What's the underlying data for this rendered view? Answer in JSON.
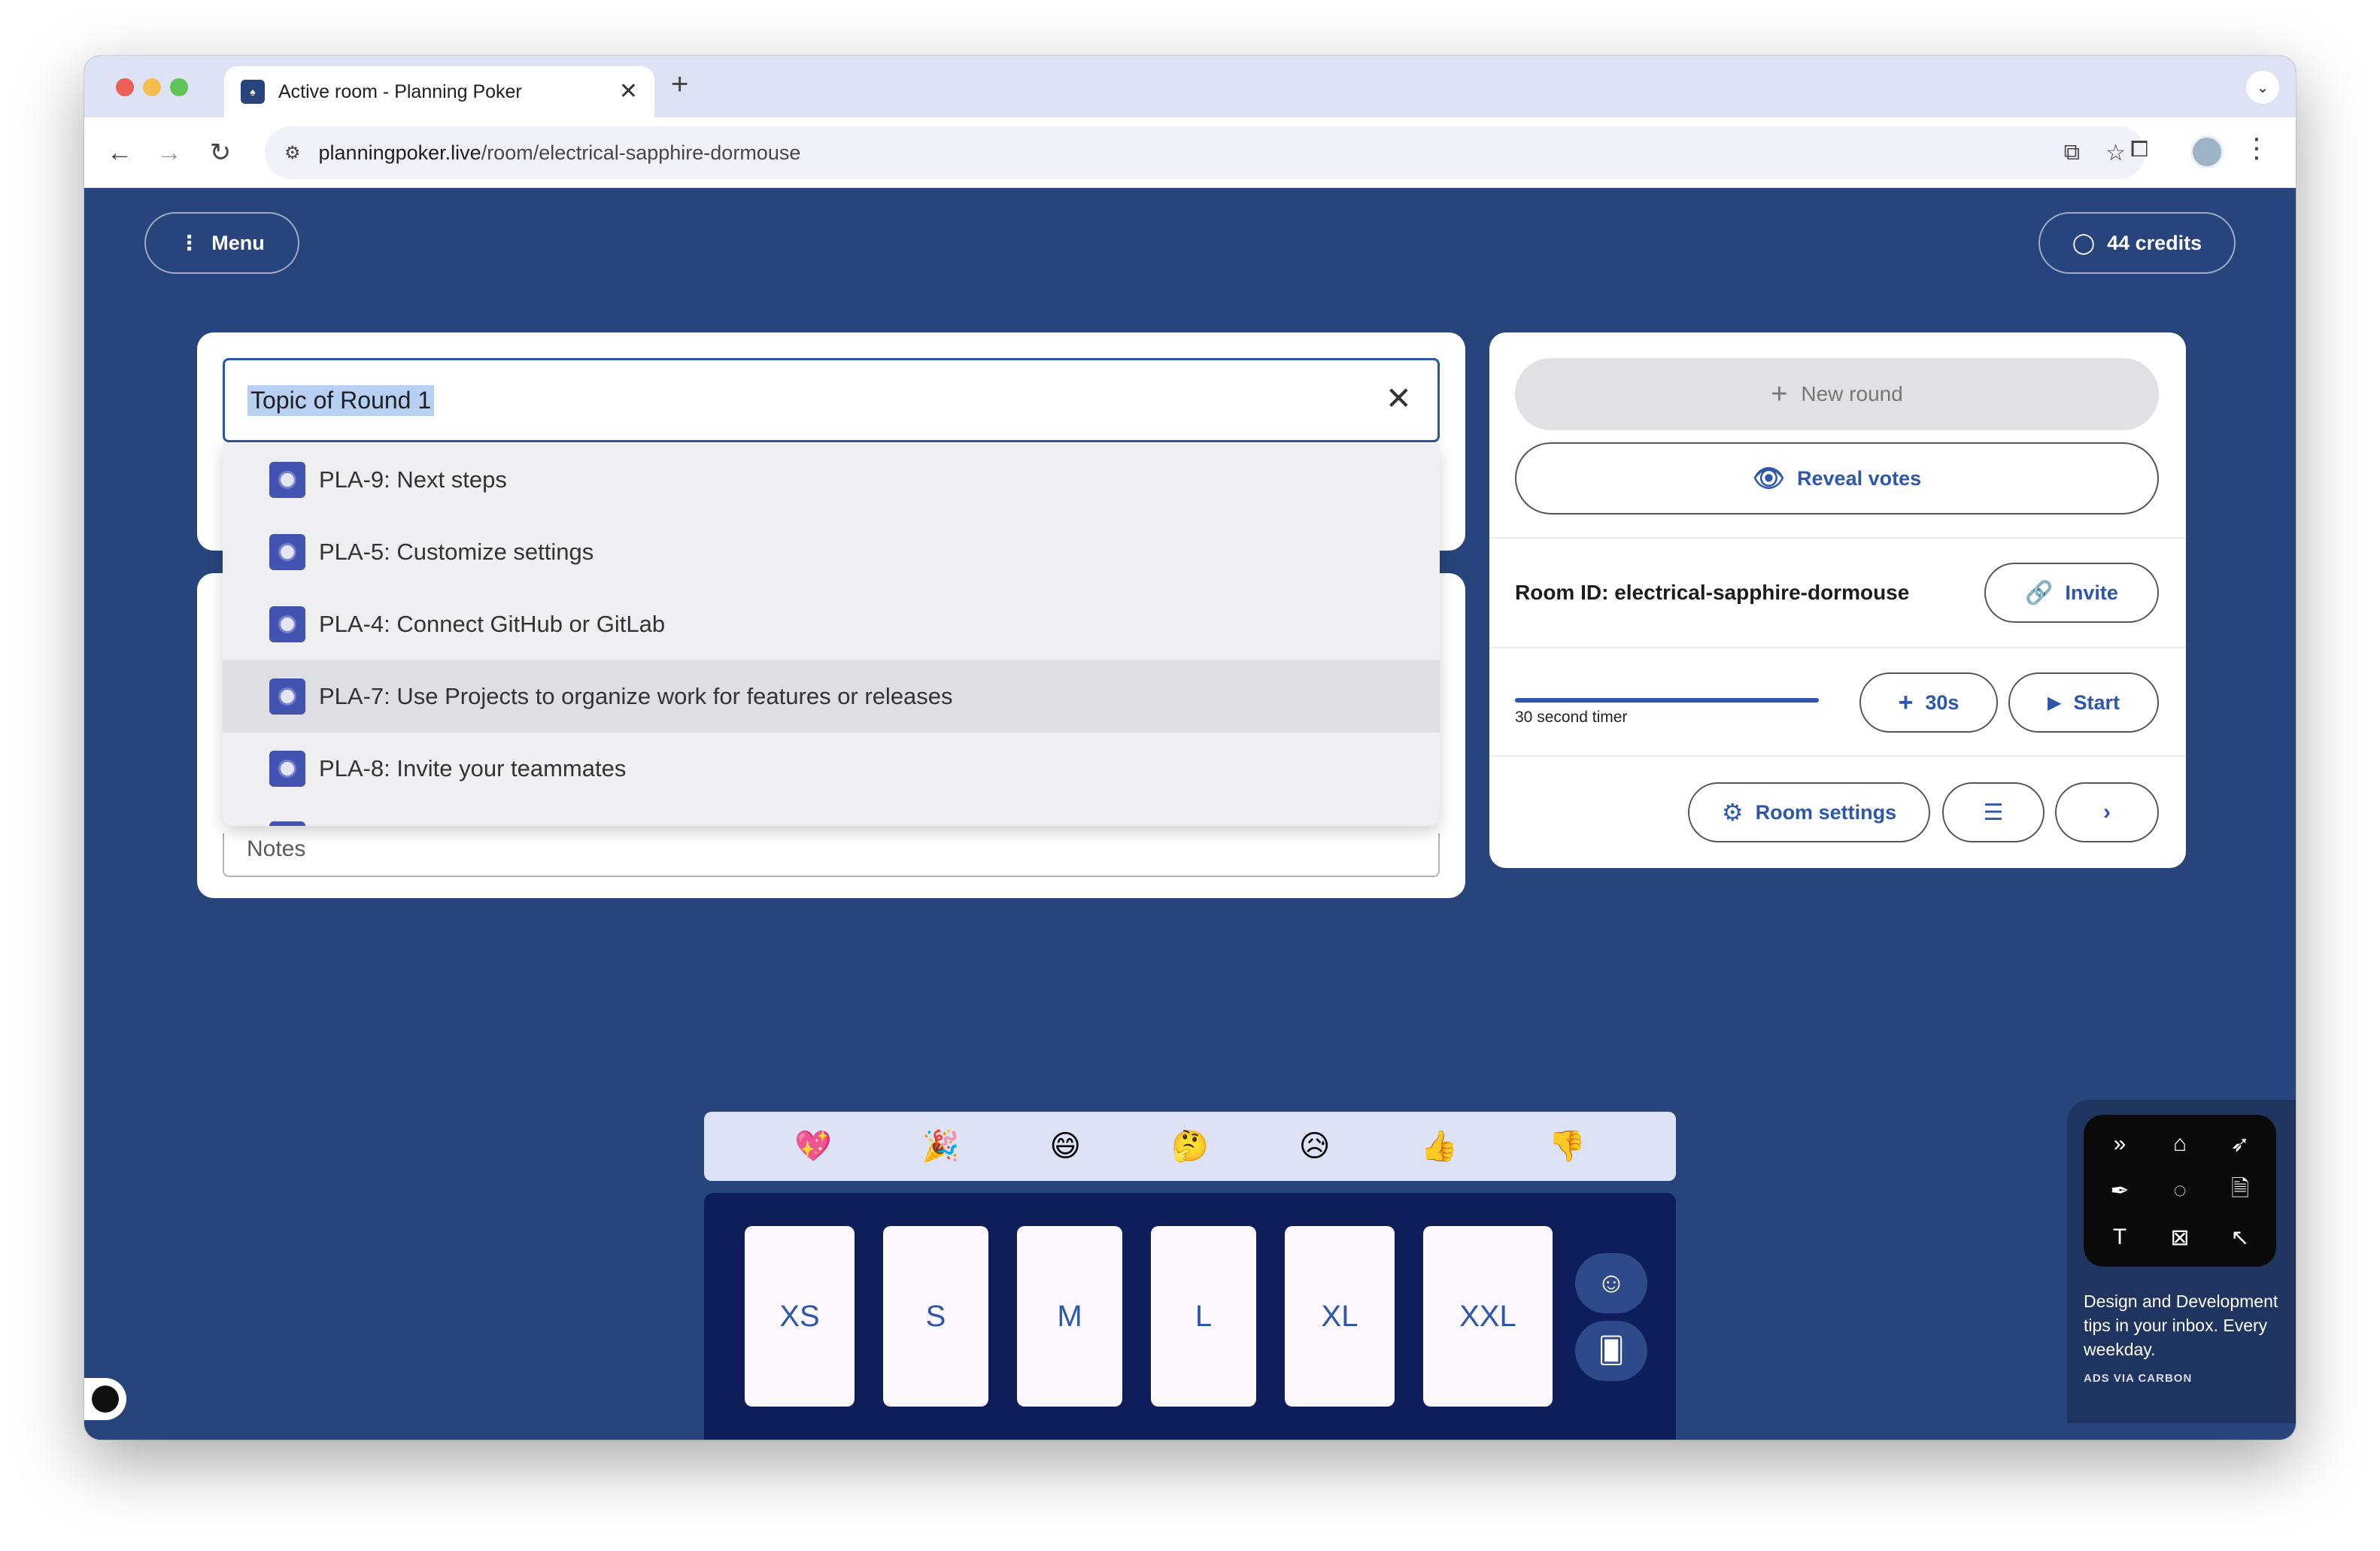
{
  "browser": {
    "tab_title": "Active room - Planning Poker",
    "tab_close": "✕",
    "new_tab": "+",
    "url_host": "planningpoker.live",
    "url_path": "/room/electrical-sapphire-dormouse"
  },
  "header": {
    "menu_label": "Menu",
    "credits_label": "44 credits"
  },
  "topic": {
    "value": "Topic of Round 1",
    "notes_placeholder": "Notes"
  },
  "suggestions": [
    {
      "label": "PLA-9: Next steps",
      "active": false
    },
    {
      "label": "PLA-5: Customize settings",
      "active": false
    },
    {
      "label": "PLA-4: Connect GitHub or GitLab",
      "active": false
    },
    {
      "label": "PLA-7: Use Projects to organize work for features or releases",
      "active": true
    },
    {
      "label": "PLA-8: Invite your teammates",
      "active": false
    }
  ],
  "actions": {
    "new_round": "New round",
    "reveal_votes": "Reveal votes",
    "room_id": "Room ID: electrical-sapphire-dormouse",
    "invite": "Invite",
    "timer_label": "30 second timer",
    "timer_progress": 1.0,
    "add_30s": "30s",
    "start": "Start",
    "room_settings": "Room settings"
  },
  "reactions": [
    "💖",
    "🎉",
    "😄",
    "🤔",
    "😥",
    "👍",
    "👎"
  ],
  "vote_cards": [
    "XS",
    "S",
    "M",
    "L",
    "XL",
    "XXL"
  ],
  "ad": {
    "text": "Design and Development tips in your inbox. Every weekday.",
    "via": "ADS VIA CARBON"
  },
  "colors": {
    "page_bg": "#27457c",
    "accent": "#2c57ad",
    "deck_bg": "#0d1e5a"
  }
}
